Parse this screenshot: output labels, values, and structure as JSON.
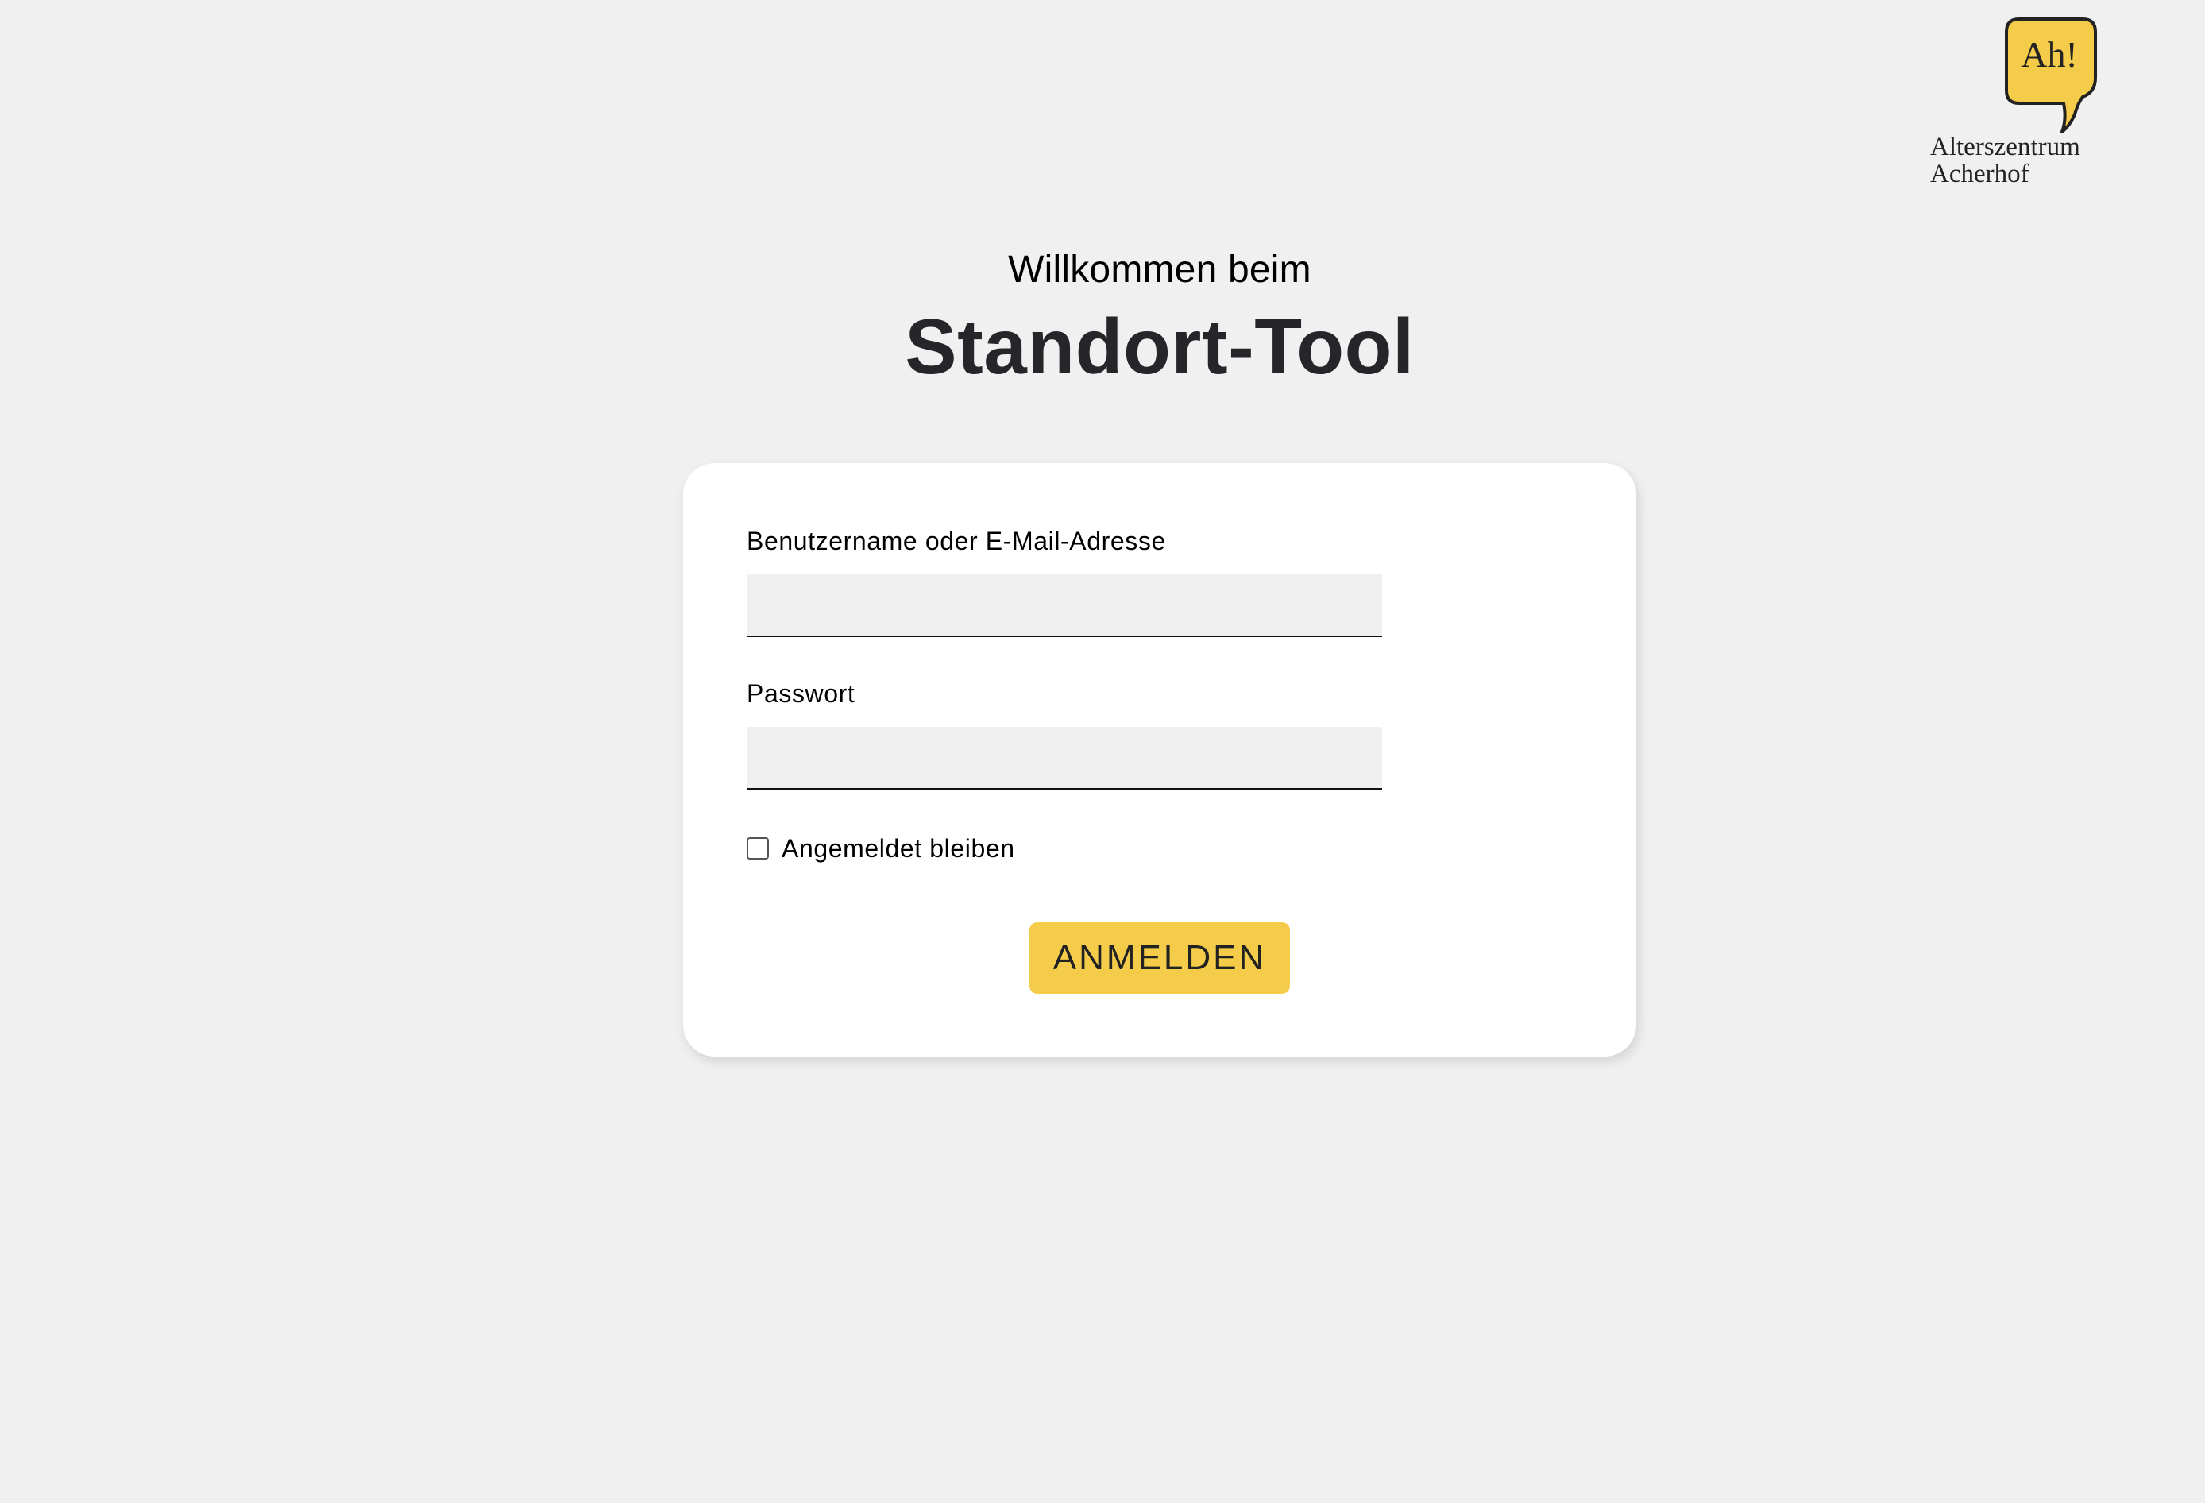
{
  "logo": {
    "bubble_text": "Ah!",
    "line1": "Alterszentrum",
    "line2": "Acherhof",
    "accent_color": "#f4cc49"
  },
  "header": {
    "welcome": "Willkommen beim",
    "title": "Standort-Tool"
  },
  "login_form": {
    "username_label": "Benutzername oder E-Mail-Adresse",
    "username_value": "",
    "password_label": "Passwort",
    "password_value": "",
    "remember_label": "Angemeldet bleiben",
    "remember_checked": false,
    "submit_label": "ANMELDEN",
    "submit_color": "#f4cc49"
  }
}
